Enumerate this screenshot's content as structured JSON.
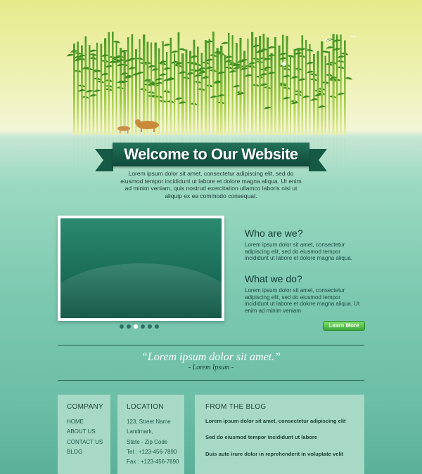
{
  "hero": {
    "title": "Welcome to Our Website",
    "intro": "Lorem ipsum dolor sit amet, consectetur adipiscing elit, sed do eiusmod tempor incididunt ut labore et dolore magna aliqua. Ut enim ad minim veniam, quis nostrud exercitation ullamco laboris nisi ut aliquip ex ea commodo consequat."
  },
  "slider": {
    "dot_count": 6,
    "active_dot": 2
  },
  "info": {
    "who_title": "Who are we?",
    "who_text": "Lorem ipsum dolor sit amet, consectetur adipiscing elit, sed do eiusmod tempor incididunt ut labore et dolore magna aliqua.",
    "what_title": "What we do?",
    "what_text": "Lorem ipsum dolor sit amet, consectetur adipiscing elit, sed do eiusmod tempor incididunt ut labore et dolore magna aliqua. Ut enim ad minim veniam",
    "learn_more": "Learn More"
  },
  "quote": {
    "text": "“Lorem ipsum dolor sit amet.”",
    "author": "- Lorem Ipsum -"
  },
  "footer": {
    "company": {
      "title": "COMPANY",
      "links": [
        "HOME",
        "ABOUT US",
        "CONTACT US",
        "BLOG"
      ]
    },
    "location": {
      "title": "LOCATION",
      "lines": [
        "123, Street Name",
        "Landmark,",
        "State - Zip Code",
        "Tel : +123-456-7890",
        "Fax : +123-456-7890"
      ]
    },
    "blog": {
      "title": "FROM THE BLOG",
      "items": [
        "Lorem ipsum dolor sit amet, consectetur adipiscing elit",
        "Sed do eiusmod tempor incididunt ut labore",
        "Duis aute irure dolor in reprehenderit in voluptate velit"
      ]
    }
  },
  "colors": {
    "ribbon": "#165a45",
    "button": "#3da83a",
    "footer_box": "#a7d9c6"
  }
}
